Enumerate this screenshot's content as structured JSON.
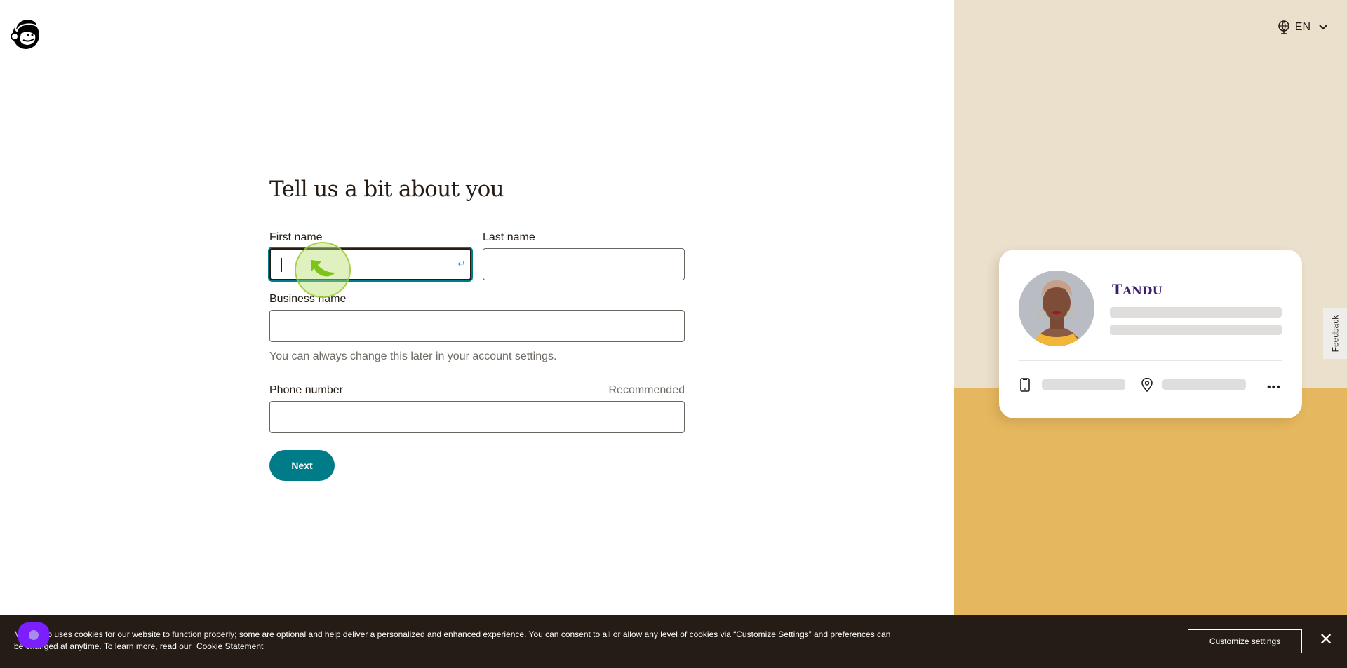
{
  "header": {
    "logo": "mailchimp-freddie-logo",
    "language": {
      "icon": "globe-icon",
      "label": "EN",
      "dropdown_icon": "chevron-down-icon"
    }
  },
  "form": {
    "title": "Tell us a bit about you",
    "first_name": {
      "label": "First name",
      "value": "",
      "placeholder": ""
    },
    "last_name": {
      "label": "Last name",
      "value": "",
      "placeholder": ""
    },
    "business_name": {
      "label": "Business name",
      "value": "",
      "placeholder": "",
      "hint": "You can always change this later in your account settings."
    },
    "phone_number": {
      "label": "Phone number",
      "aux": "Recommended",
      "value": "",
      "placeholder": ""
    },
    "next_label": "Next"
  },
  "preview_card": {
    "brand_name_first": "T",
    "brand_name_rest": "ANDU",
    "icons": [
      "phone-icon",
      "location-pin-icon",
      "more-icon"
    ]
  },
  "feedback_tab": {
    "label": "Feedback"
  },
  "cookie_banner": {
    "text": "Mailchimp uses cookies for our website to function properly; some are optional and help deliver a personalized and enhanced experience. You can consent to all or allow any level of cookies via “Customize Settings” and preferences can be changed at anytime. To learn more, read our",
    "link_label": "Cookie Statement",
    "customize_label": "Customize settings",
    "close_icon": "close-icon"
  },
  "colors": {
    "accent": "#007c89",
    "text": "#241c15",
    "panel_beige": "#ebe0cc",
    "panel_gold": "#e5b75e",
    "brand_purple": "#3b1e6a",
    "cookie_bg": "#241c15"
  }
}
